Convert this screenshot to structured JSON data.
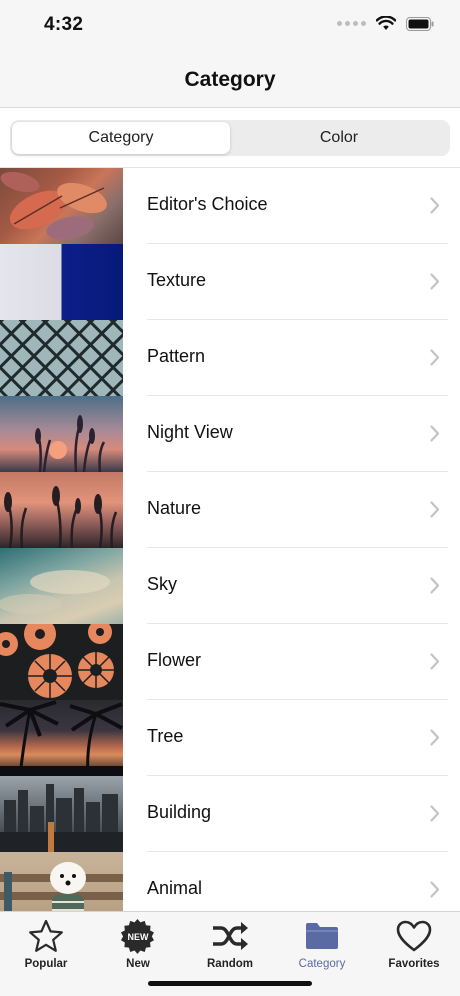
{
  "status": {
    "time": "4:32"
  },
  "nav": {
    "title": "Category"
  },
  "segments": [
    {
      "label": "Category",
      "selected": true
    },
    {
      "label": "Color",
      "selected": false
    }
  ],
  "categories": [
    {
      "label": "Editor's Choice",
      "thumb": "autumn-leaves"
    },
    {
      "label": "Texture",
      "thumb": "blue-white-split"
    },
    {
      "label": "Pattern",
      "thumb": "diamond-lattice"
    },
    {
      "label": "Night View",
      "thumb": "dusk-grass"
    },
    {
      "label": "Nature",
      "thumb": "sunset-plants"
    },
    {
      "label": "Sky",
      "thumb": "teal-sky"
    },
    {
      "label": "Flower",
      "thumb": "orange-daisies"
    },
    {
      "label": "Tree",
      "thumb": "palm-sunset"
    },
    {
      "label": "Building",
      "thumb": "city-skyline"
    },
    {
      "label": "Animal",
      "thumb": "white-dog-bench"
    }
  ],
  "tabs": [
    {
      "label": "Popular",
      "icon": "star-icon",
      "active": false
    },
    {
      "label": "New",
      "icon": "new-badge-icon",
      "badge": "NEW",
      "active": false
    },
    {
      "label": "Random",
      "icon": "shuffle-icon",
      "active": false
    },
    {
      "label": "Category",
      "icon": "folder-icon",
      "active": true
    },
    {
      "label": "Favorites",
      "icon": "heart-icon",
      "active": false
    }
  ],
  "colors": {
    "accent": "#5a6aa3",
    "bar_bg": "#f6f6f6"
  }
}
